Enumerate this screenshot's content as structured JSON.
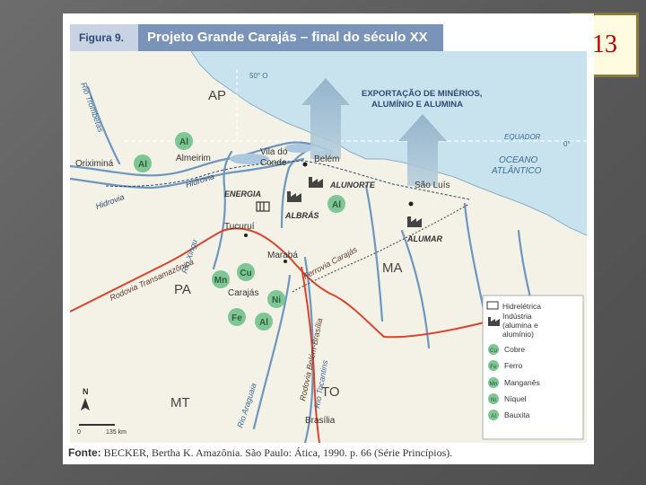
{
  "slide_number": "13",
  "figure": {
    "label": "Figura 9.",
    "title": "Projeto Grande Carajás – final do século XX",
    "source_prefix": "Fonte:",
    "source_text": "BECKER, Bertha K. Amazônia. São Paulo: Ática, 1990. p. 66 (Série Princípios)."
  },
  "map": {
    "states": {
      "ap": "AP",
      "pa": "PA",
      "ma": "MA",
      "to": "TO",
      "mt": "MT"
    },
    "lines": {
      "lat_50": "50° O",
      "equator": "EQUADOR",
      "eq_deg": "0°"
    },
    "ocean": {
      "line1": "OCEANO",
      "line2": "ATLÂNTICO"
    },
    "export": {
      "line1": "EXPORTAÇÃO DE MINÉRIOS,",
      "line2": "ALUMÍNIO E ALUMINA"
    },
    "cities": {
      "almeirim": "Almeirim",
      "oriximina": "Oriximiná",
      "vila_do_conde_1": "Vila do",
      "vila_do_conde_2": "Conde",
      "belem": "Belém",
      "sao_luis": "São Luís",
      "tucurui": "Tucuruí",
      "maraba": "Marabá",
      "carajas": "Carajás",
      "brasilia": "Brasília"
    },
    "labels": {
      "alunorte": "ALUNORTE",
      "albras": "ALBRÁS",
      "alumar": "ALUMAR",
      "energia": "ENERGIA",
      "hidrovia_1": "Hidrovia",
      "hidrovia_2": "Hidrovia",
      "rio_trombetas": "Rio Trombetas",
      "rio_xingu": "Rio Xingu",
      "rio_araguaia": "Rio Araguaia",
      "rio_tocantins": "Rio Tocantins",
      "rodovia_transamazonica": "Rodovia Transamazônica",
      "ferrovia_carajas": "Ferrovia Carajás",
      "rodovia_belem_brasilia": "Rodovia Belém-Brasília"
    },
    "minerals": {
      "al": "Al",
      "mn": "Mn",
      "cu": "Cu",
      "ni": "Ni",
      "fe": "Fe"
    },
    "scale": {
      "zero": "0",
      "distance": "135 km"
    },
    "north": "N",
    "legend": {
      "hydro": "Hidrelétrica",
      "industry_1": "Indústria",
      "industry_2": "(alumina e",
      "industry_3": "alumínio)",
      "copper": "Cobre",
      "iron": "Ferro",
      "manganese": "Manganês",
      "nickel": "Níquel",
      "bauxite": "Bauxita"
    },
    "colors": {
      "land": "#f4f1e6",
      "ocean": "#c9e3ee",
      "river": "#6e97bf",
      "road": "#d9442c",
      "mineral": "#7ec694",
      "header": "#7a93b8",
      "arrow": "#a9c5d8"
    }
  }
}
